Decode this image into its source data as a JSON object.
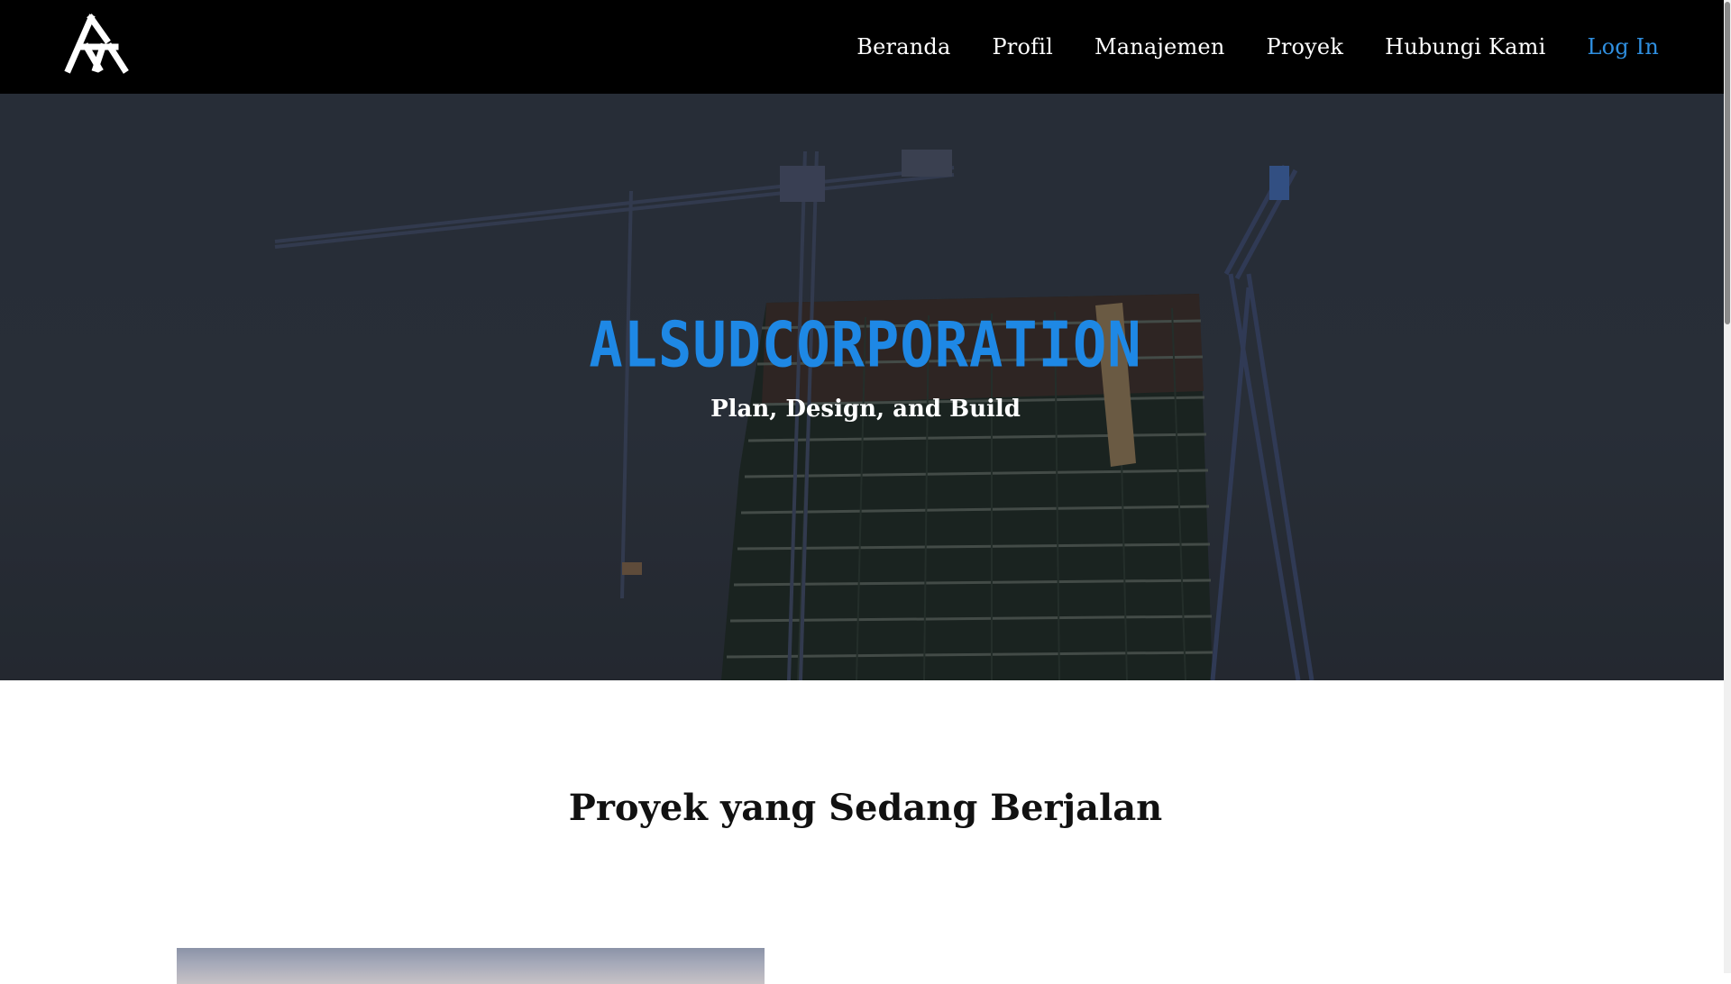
{
  "nav": {
    "items": [
      {
        "label": "Beranda"
      },
      {
        "label": "Profil"
      },
      {
        "label": "Manajemen"
      },
      {
        "label": "Proyek"
      },
      {
        "label": "Hubungi Kami"
      }
    ],
    "login_label": "Log In",
    "login_color": "#2f8fe0"
  },
  "hero": {
    "title": "ALSUDCORPORATION",
    "subtitle": "Plan, Design, and Build",
    "title_color": "#1e88e5"
  },
  "section": {
    "title": "Proyek yang Sedang Berjalan"
  },
  "icons": {
    "logo": "company-logo-icon"
  }
}
